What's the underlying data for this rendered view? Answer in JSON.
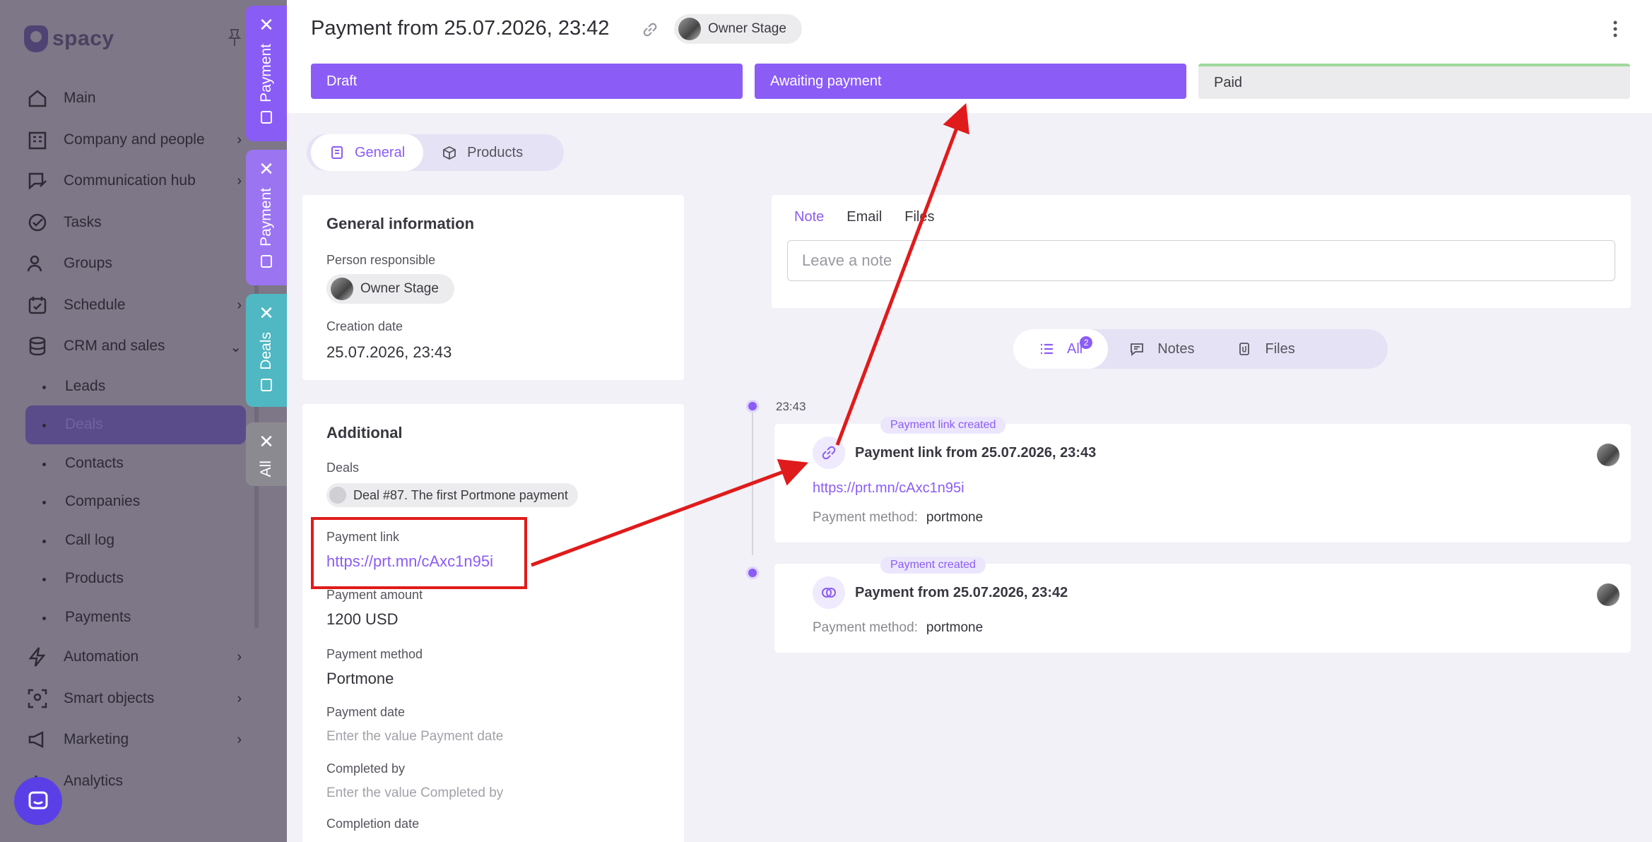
{
  "sidebar": {
    "logo_text": "spacy",
    "items": [
      {
        "label": "Main",
        "icon": "home-icon"
      },
      {
        "label": "Company and people",
        "icon": "company-icon"
      },
      {
        "label": "Communication hub",
        "icon": "chat-edit-icon"
      },
      {
        "label": "Tasks",
        "icon": "check-circle-icon"
      },
      {
        "label": "Groups",
        "icon": "users-icon"
      },
      {
        "label": "Schedule",
        "icon": "calendar-icon"
      },
      {
        "label": "CRM and sales",
        "icon": "database-icon"
      }
    ],
    "crm_sub": [
      "Leads",
      "Deals",
      "Contacts",
      "Companies",
      "Call log",
      "Products",
      "Payments"
    ],
    "bottom_items": [
      {
        "label": "Automation",
        "icon": "bolt-icon"
      },
      {
        "label": "Smart objects",
        "icon": "scan-icon"
      },
      {
        "label": "Marketing",
        "icon": "megaphone-icon"
      },
      {
        "label": "Analytics",
        "icon": "chart-icon"
      }
    ]
  },
  "side_tabs": [
    {
      "label": "Payment",
      "color": "#8a5cf6"
    },
    {
      "label": "Payment",
      "color": "#9b74f2"
    },
    {
      "label": "Deals",
      "color": "#4fb8c3"
    },
    {
      "label": "All",
      "color": "#8c8a91"
    }
  ],
  "header": {
    "title": "Payment from 25.07.2026, 23:42",
    "owner": "Owner Stage",
    "stages": [
      "Draft",
      "Awaiting payment",
      "Paid"
    ]
  },
  "tabs": {
    "general": "General",
    "products": "Products"
  },
  "general": {
    "heading": "General information",
    "person_label": "Person responsible",
    "person_value": "Owner Stage",
    "creation_label": "Creation date",
    "creation_value": "25.07.2026, 23:43"
  },
  "additional": {
    "heading": "Additional",
    "deals_label": "Deals",
    "deals_value": "Deal #87. The first Portmone payment",
    "link_label": "Payment link",
    "link_value": "https://prt.mn/cAxc1n95i",
    "amount_label": "Payment amount",
    "amount_value": "1200 USD",
    "method_label": "Payment method",
    "method_value": "Portmone",
    "date_label": "Payment date",
    "date_placeholder": "Enter the value Payment date",
    "completed_label": "Completed by",
    "completed_placeholder": "Enter the value Completed by",
    "completion_label": "Completion date"
  },
  "note": {
    "tabs": [
      "Note",
      "Email",
      "Files"
    ],
    "placeholder": "Leave a note"
  },
  "filter": {
    "all": "All",
    "all_count": "2",
    "notes": "Notes",
    "files": "Files"
  },
  "timeline": {
    "time": "23:43",
    "events": [
      {
        "tag": "Payment link created",
        "title": "Payment link from 25.07.2026, 23:43",
        "link": "https://prt.mn/cAxc1n95i",
        "method_key": "Payment method:",
        "method_val": "portmone"
      },
      {
        "tag": "Payment created",
        "title": "Payment from 25.07.2026, 23:42",
        "method_key": "Payment method:",
        "method_val": "portmone"
      }
    ]
  },
  "colors": {
    "accent": "#8b5cf6",
    "annotation": "#e01b1b",
    "paid_stage_line": "#9fd89a"
  }
}
